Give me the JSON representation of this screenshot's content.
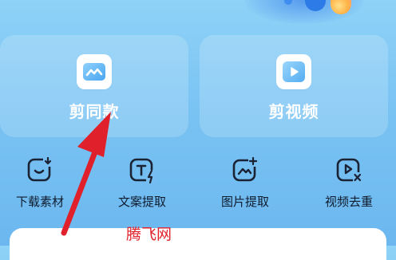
{
  "cards": [
    {
      "label": "剪同款",
      "icon": "template-icon"
    },
    {
      "label": "剪视频",
      "icon": "play-icon"
    }
  ],
  "tools": [
    {
      "label": "下载素材",
      "icon": "download-icon"
    },
    {
      "label": "文案提取",
      "icon": "text-extract-icon"
    },
    {
      "label": "图片提取",
      "icon": "image-extract-icon"
    },
    {
      "label": "视频去重",
      "icon": "video-dedupe-icon"
    }
  ],
  "watermark": "腾飞网",
  "colors": {
    "accent": "#5aa7ee",
    "icon_bg": "#ffffff",
    "annotation_arrow": "#e0202a"
  }
}
